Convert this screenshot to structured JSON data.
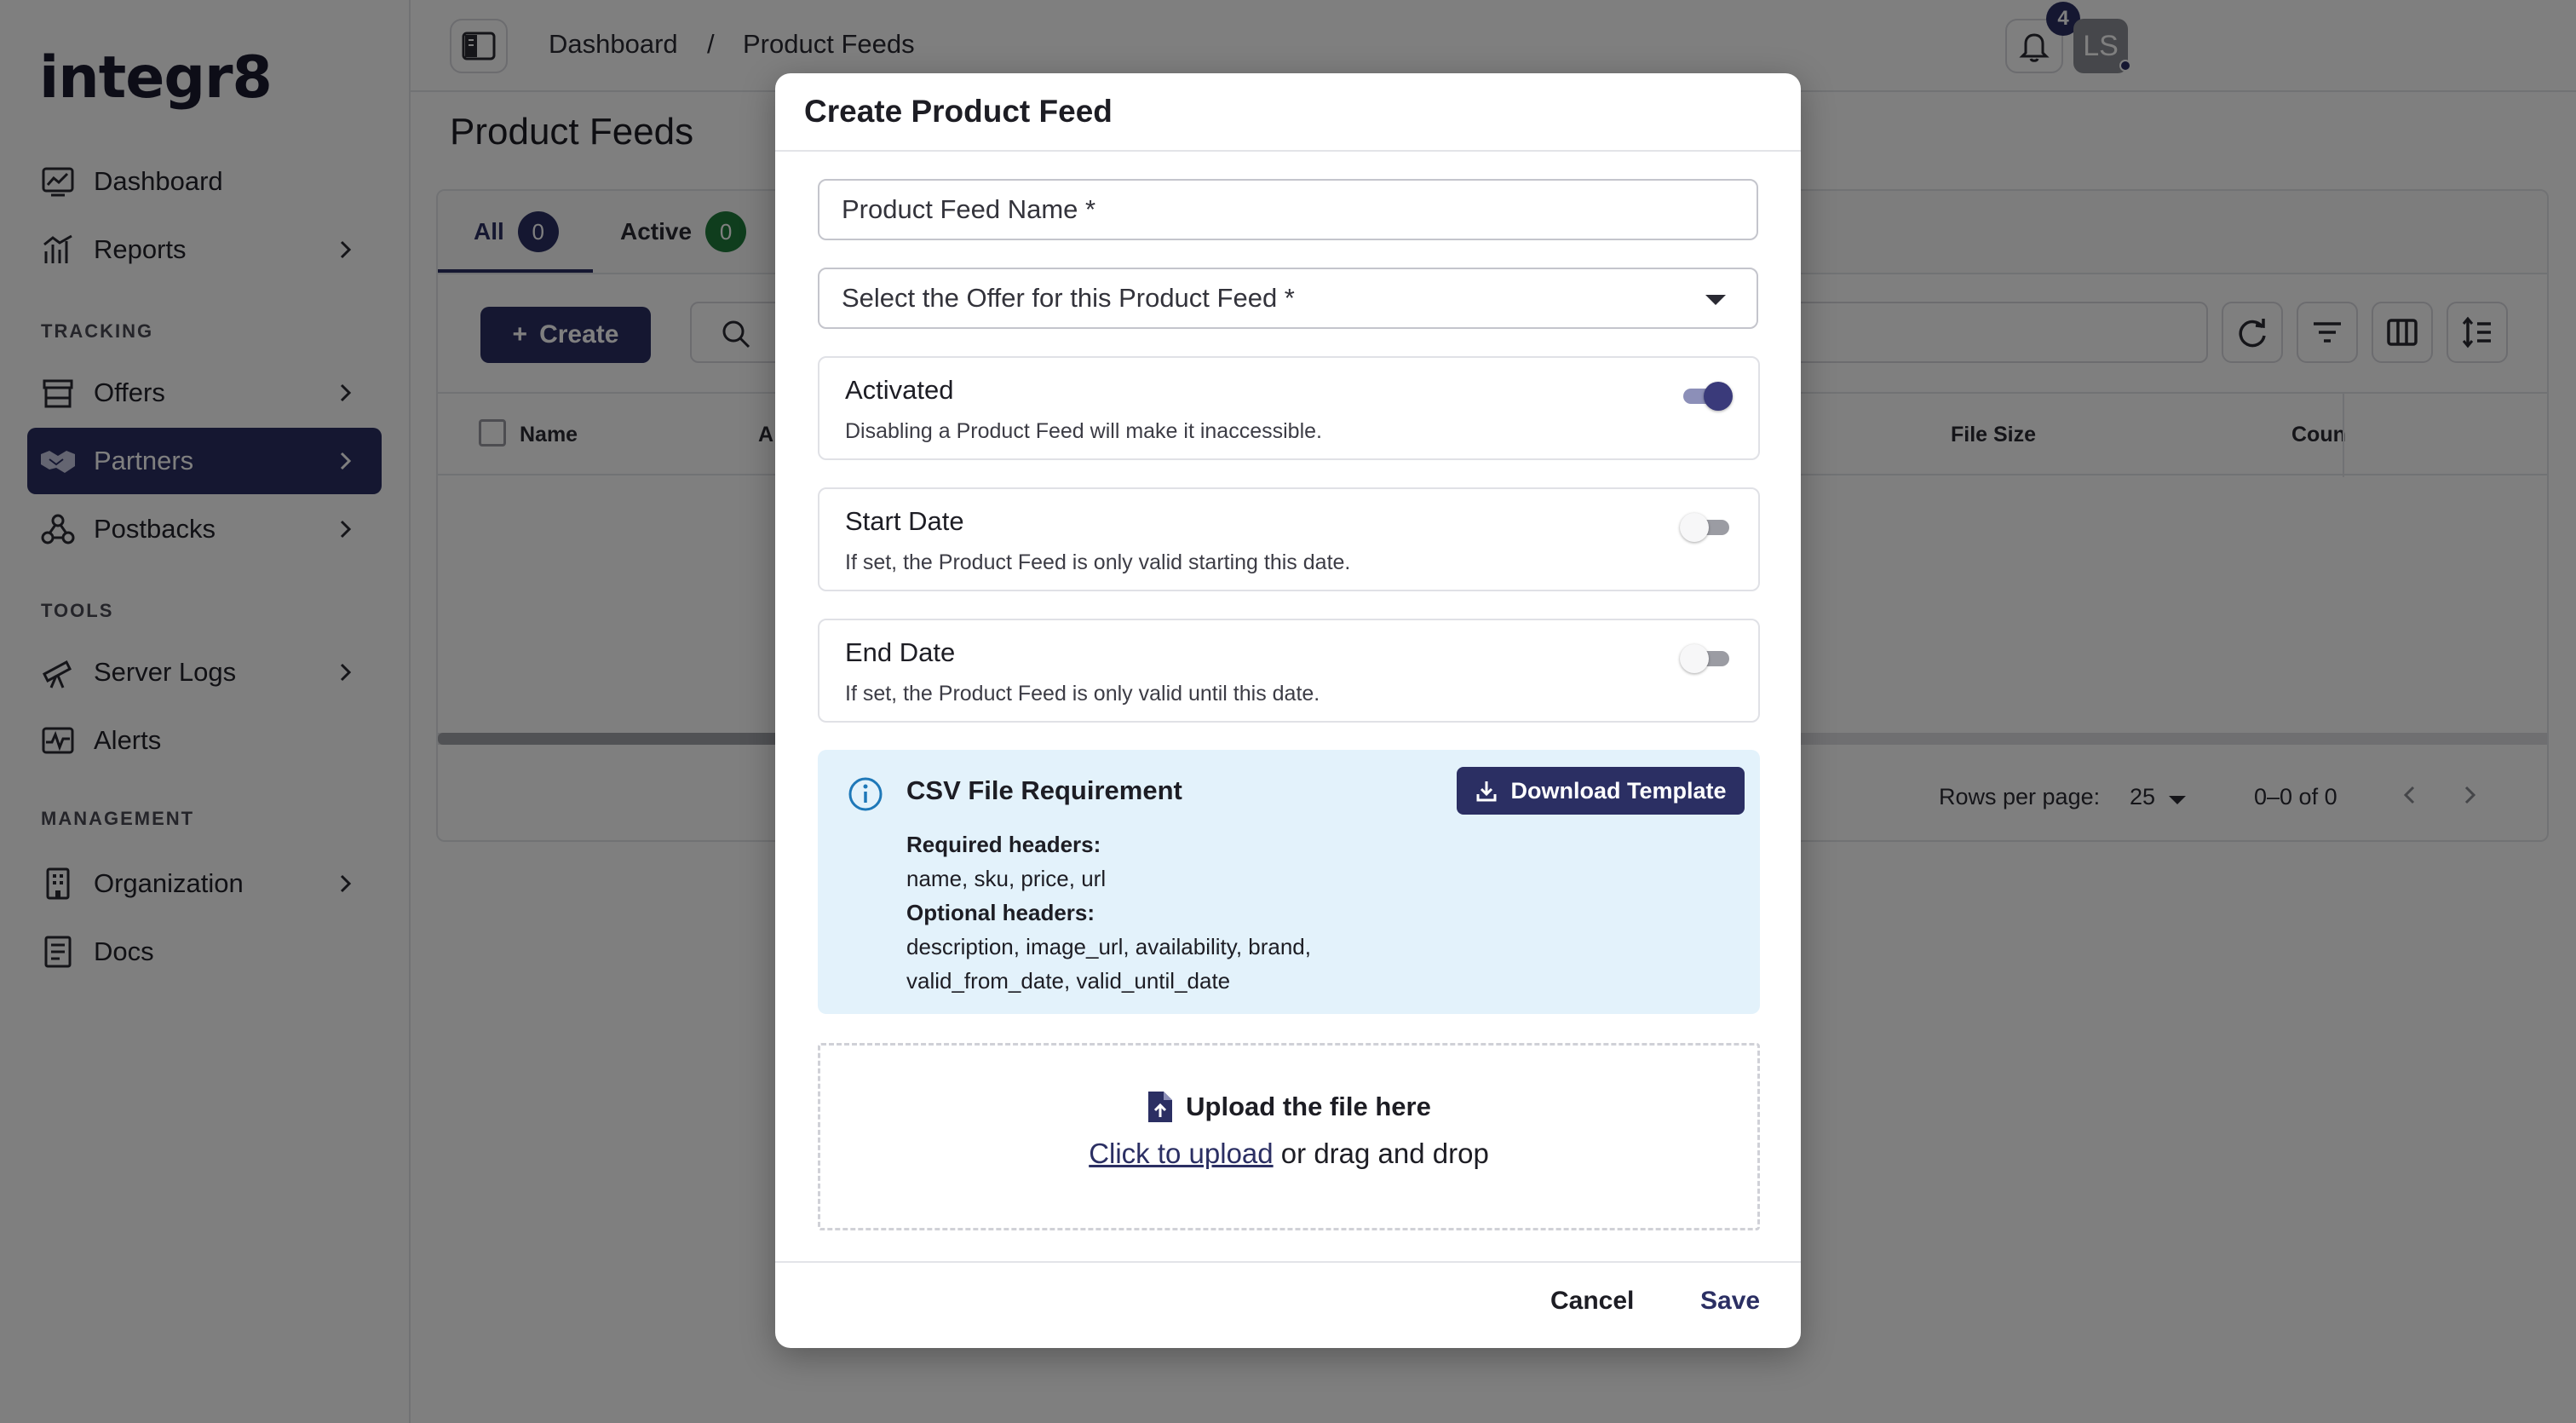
{
  "app": {
    "logo": "integr8"
  },
  "sidebar": {
    "items": [
      {
        "label": "Dashboard",
        "icon": "dashboard-chart-icon",
        "has_chevron": false
      },
      {
        "label": "Reports",
        "icon": "reports-chart-icon",
        "has_chevron": true
      }
    ],
    "sections": [
      {
        "label": "TRACKING",
        "items": [
          {
            "label": "Offers",
            "icon": "store-icon",
            "has_chevron": true
          },
          {
            "label": "Partners",
            "icon": "handshake-icon",
            "has_chevron": true,
            "active": true
          },
          {
            "label": "Postbacks",
            "icon": "webhook-icon",
            "has_chevron": true
          }
        ]
      },
      {
        "label": "TOOLS",
        "items": [
          {
            "label": "Server Logs",
            "icon": "telescope-icon",
            "has_chevron": true
          },
          {
            "label": "Alerts",
            "icon": "pulse-icon",
            "has_chevron": false
          }
        ]
      },
      {
        "label": "MANAGEMENT",
        "items": [
          {
            "label": "Organization",
            "icon": "building-icon",
            "has_chevron": true
          },
          {
            "label": "Docs",
            "icon": "document-icon",
            "has_chevron": false
          }
        ]
      }
    ]
  },
  "topbar": {
    "breadcrumb": [
      "Dashboard",
      "/",
      "Product Feeds"
    ],
    "notification_count": "4",
    "avatar_initials": "LS"
  },
  "page": {
    "title": "Product Feeds",
    "tabs": [
      {
        "label": "All",
        "count": "0",
        "color": "#2b2f63"
      },
      {
        "label": "Active",
        "count": "0",
        "color": "#1f7a3a"
      }
    ],
    "create_label": "Create",
    "table": {
      "columns": [
        "Name",
        "A",
        "File Size",
        "Coun"
      ]
    },
    "pagination": {
      "rows_per_page_label": "Rows per page:",
      "rows_per_page_value": "25",
      "range": "0–0 of 0"
    }
  },
  "modal": {
    "title": "Create Product Feed",
    "name_field": {
      "placeholder": "Product Feed Name *"
    },
    "offer_select": {
      "placeholder": "Select the Offer for this Product Feed *"
    },
    "options": [
      {
        "title": "Activated",
        "description": "Disabling a Product Feed will make it inaccessible.",
        "enabled": true
      },
      {
        "title": "Start Date",
        "description": "If set, the Product Feed is only valid starting this date.",
        "enabled": false
      },
      {
        "title": "End Date",
        "description": "If set, the Product Feed is only valid until this date.",
        "enabled": false
      }
    ],
    "csv_info": {
      "title": "CSV File Requirement",
      "download_label": "Download Template",
      "required_label": "Required headers:",
      "required_value": "name, sku, price, url",
      "optional_label": "Optional headers:",
      "optional_value_1": "description, image_url, availability, brand,",
      "optional_value_2": "valid_from_date, valid_until_date"
    },
    "upload": {
      "title": "Upload the file here",
      "link": "Click to upload",
      "suffix": " or drag and drop"
    },
    "cancel_label": "Cancel",
    "save_label": "Save"
  },
  "colors": {
    "accent": "#2b2f63",
    "info_bg": "#e3f2fb",
    "success": "#1f7a3a"
  }
}
